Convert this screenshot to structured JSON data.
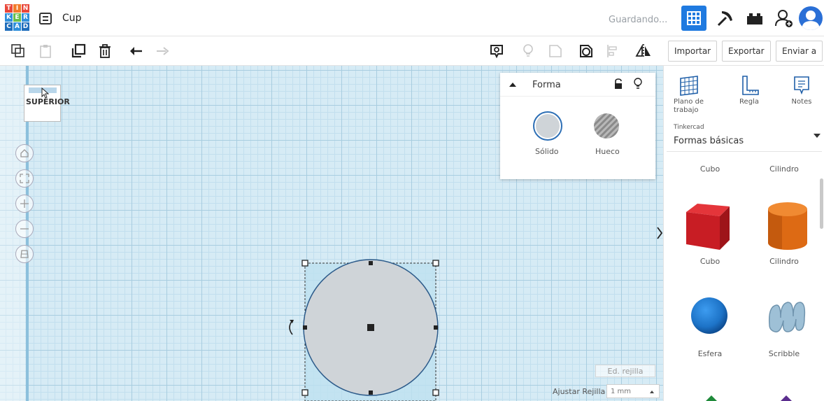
{
  "app": {
    "logo_letters": [
      "T",
      "I",
      "N",
      "K",
      "E",
      "R",
      "C",
      "A",
      "D"
    ],
    "design_title": "Cup",
    "status": "Guardando..."
  },
  "toolbar": {
    "import_label": "Importar",
    "export_label": "Exportar",
    "send_label": "Enviar a"
  },
  "viewcube": {
    "face_label": "SUPERIOR"
  },
  "shape_panel": {
    "title": "Forma",
    "solid_label": "Sólido",
    "hole_label": "Hueco"
  },
  "grid": {
    "edit_label": "Ed. rejilla",
    "snap_label": "Ajustar Rejilla",
    "snap_value": "1 mm"
  },
  "library": {
    "tools": [
      {
        "label": "Plano de\ntrabajo"
      },
      {
        "label": "Regla"
      },
      {
        "label": "Notes"
      }
    ],
    "source_small": "Tinkercad",
    "source_value": "Formas básicas",
    "top_labels": [
      "Cubo",
      "Cilindro"
    ],
    "shapes": [
      {
        "label": "Cubo",
        "color": "#d32027"
      },
      {
        "label": "Cilindro",
        "color": "#e8731a"
      },
      {
        "label": "Esfera",
        "color": "#1d73c7"
      },
      {
        "label": "Scribble",
        "color": "#8fb3c9"
      }
    ]
  },
  "colors": {
    "accent": "#1f7ae0",
    "grid_bg": "#d6ebf5",
    "selected_shape": "#cfd4d8"
  }
}
